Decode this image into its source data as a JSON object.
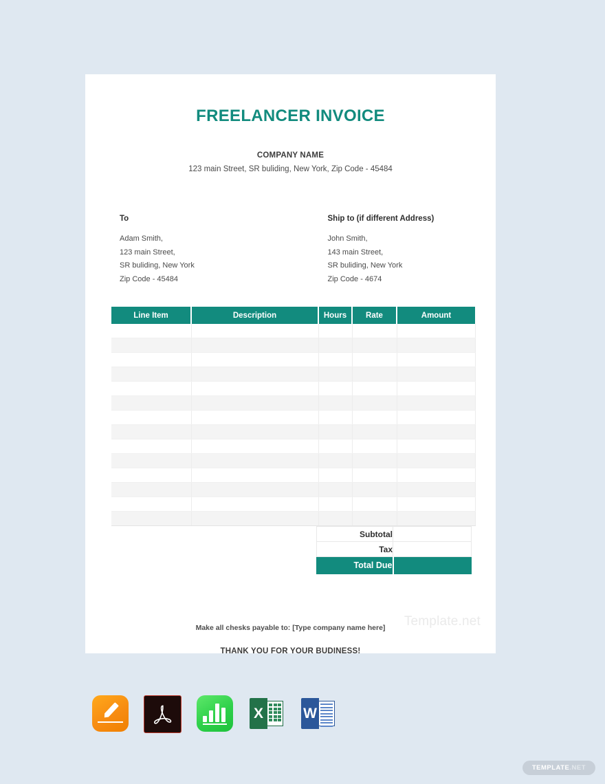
{
  "page": {
    "background_color": "#dfe8f1",
    "accent_color": "#128b7e"
  },
  "document": {
    "title": "FREELANCER INVOICE",
    "company": {
      "name": "COMPANY NAME",
      "address": "123 main Street, SR buliding, New York, Zip Code - 45484"
    },
    "bill_to": {
      "heading": "To",
      "lines": [
        "Adam Smith,",
        "123 main Street,",
        "SR buliding, New York",
        "Zip Code - 45484"
      ]
    },
    "ship_to": {
      "heading": "Ship to (if different Address)",
      "lines": [
        "John Smith,",
        "143 main Street,",
        "SR buliding, New York",
        "Zip Code - 4674"
      ]
    },
    "table": {
      "columns": [
        "Line Item",
        "Description",
        "Hours",
        "Rate",
        "Amount"
      ],
      "row_count": 14,
      "rows": []
    },
    "totals": [
      {
        "label": "Subtotal",
        "value": ""
      },
      {
        "label": "Tax",
        "value": ""
      },
      {
        "label": "Total Due",
        "value": ""
      }
    ],
    "footer": {
      "payable": "Make all chesks payable to: [Type company name here]",
      "thanks": "THANK YOU FOR YOUR BUDINESS!",
      "watermark": "Template.net"
    }
  },
  "formats": [
    {
      "name": "apple-pages",
      "label": "Pages"
    },
    {
      "name": "adobe-pdf",
      "label": "PDF"
    },
    {
      "name": "apple-numbers",
      "label": "Numbers"
    },
    {
      "name": "microsoft-excel",
      "label": "X"
    },
    {
      "name": "microsoft-word",
      "label": "W"
    }
  ],
  "badge": {
    "primary": "TEMPLATE",
    "secondary": ".NET"
  }
}
